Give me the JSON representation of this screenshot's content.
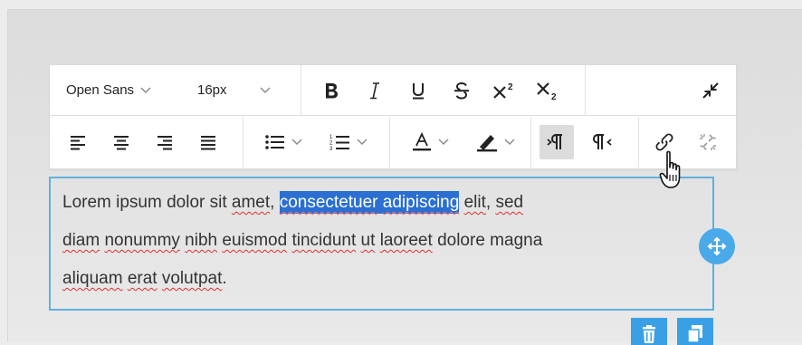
{
  "toolbar": {
    "font_family": "Open Sans",
    "font_size": "16px",
    "row1_icons": [
      "bold-icon",
      "italic-icon",
      "underline-icon",
      "strikethrough-icon",
      "superscript-icon",
      "subscript-icon",
      "collapse-icon"
    ],
    "row2_icons": [
      "align-left-icon",
      "align-center-icon",
      "align-right-icon",
      "align-justify-icon",
      "bulleted-list-icon",
      "numbered-list-icon",
      "text-color-icon",
      "highlight-icon",
      "ltr-direction-icon",
      "rtl-direction-icon",
      "link-icon",
      "unlink-icon"
    ],
    "active_button": "ltr-direction"
  },
  "editor": {
    "line1_pre": "Lorem ipsum dolor sit ",
    "line1_amet": "amet",
    "line1_comma": ", ",
    "line1_sel_a": "consectetuer",
    "line1_sel_space": " ",
    "line1_sel_b": "adipiscing",
    "line1_space": " ",
    "line1_elit": "elit",
    "line1_post": ", ",
    "line1_sed": "sed",
    "line2_diam": "diam",
    "line2_s1": " ",
    "line2_nonummy": "nonummy",
    "line2_s2": " ",
    "line2_nibh": "nibh",
    "line2_s3": " ",
    "line2_euismod": "euismod",
    "line2_s4": " ",
    "line2_tincidunt": "tincidunt",
    "line2_s5": " ",
    "line2_ut": "ut",
    "line2_s6": " ",
    "line2_laoreet": "laoreet",
    "line2_post": " dolore magna",
    "line3_aliquam": "aliquam",
    "line3_s1": " ",
    "line3_erat": "erat",
    "line3_s2": " ",
    "line3_volutpat": "volutpat",
    "line3_post": "."
  },
  "colors": {
    "accent": "#4aa9e8",
    "selection": "#2a6fd1",
    "spellcheck": "#e03030",
    "border": "#5fb0e0"
  }
}
